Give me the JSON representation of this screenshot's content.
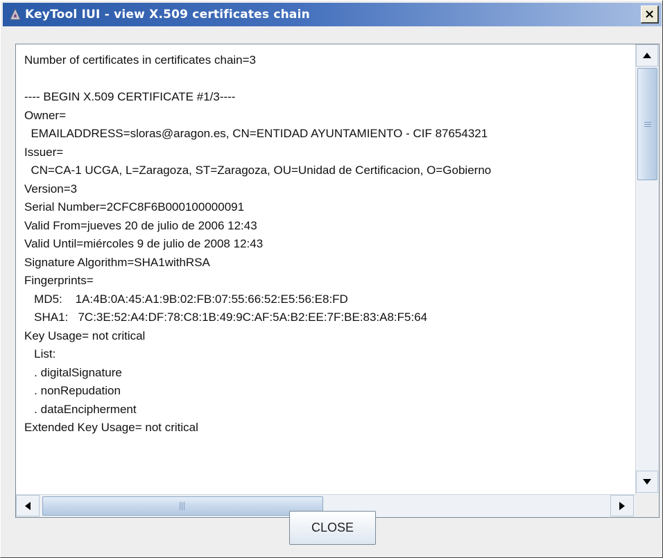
{
  "window": {
    "title": "KeyTool IUI - view X.509 certificates chain",
    "close_glyph": "×"
  },
  "certificate_text": {
    "lines": [
      "Number of certificates in certificates chain=3",
      "",
      "---- BEGIN X.509 CERTIFICATE #1/3----",
      "Owner=",
      "  EMAILADDRESS=sloras@aragon.es, CN=ENTIDAD AYUNTAMIENTO - CIF 87654321",
      "Issuer=",
      "  CN=CA-1 UCGA, L=Zaragoza, ST=Zaragoza, OU=Unidad de Certificacion, O=Gobierno",
      "Version=3",
      "Serial Number=2CFC8F6B000100000091",
      "Valid From=jueves 20 de julio de 2006 12:43",
      "Valid Until=miércoles 9 de julio de 2008 12:43",
      "Signature Algorithm=SHA1withRSA",
      "Fingerprints=",
      "   MD5:    1A:4B:0A:45:A1:9B:02:FB:07:55:66:52:E5:56:E8:FD",
      "   SHA1:   7C:3E:52:A4:DF:78:C8:1B:49:9C:AF:5A:B2:EE:7F:BE:83:A8:F5:64",
      "Key Usage= not critical",
      "   List:",
      "   . digitalSignature",
      "   . nonRepudation",
      "   . dataEncipherment",
      "Extended Key Usage= not critical"
    ]
  },
  "buttons": {
    "close_label": "CLOSE"
  }
}
